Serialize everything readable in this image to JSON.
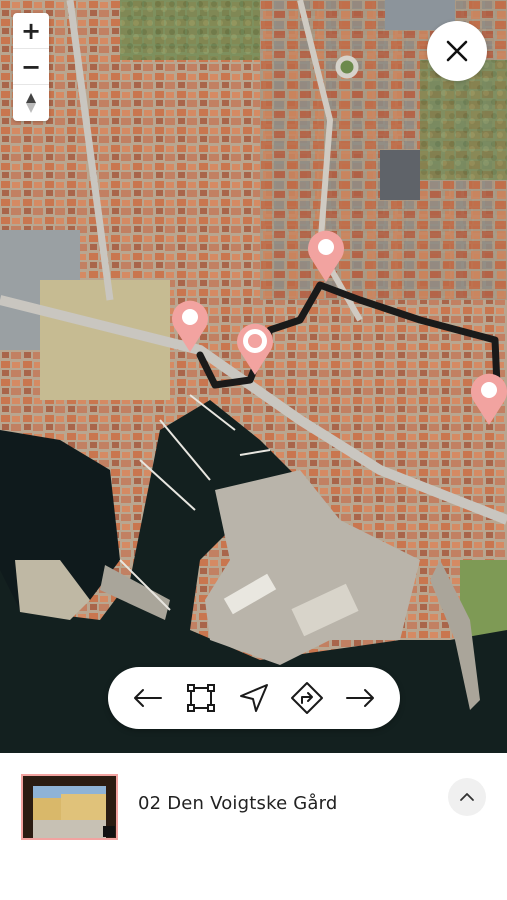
{
  "map": {
    "zoom_in_label": "+",
    "zoom_out_label": "−",
    "compass_icon": "compass-north-icon",
    "close_icon": "close-icon",
    "route_color": "#1a1a1a",
    "pin_color": "#f2a3a0",
    "pins": [
      {
        "name": "map-pin-current",
        "state": "active"
      },
      {
        "name": "map-pin-1",
        "state": "default"
      },
      {
        "name": "map-pin-2",
        "state": "default"
      },
      {
        "name": "map-pin-3",
        "state": "default"
      }
    ]
  },
  "toolbar": {
    "items": [
      {
        "icon": "arrow-left-icon",
        "action": "previous"
      },
      {
        "icon": "fit-bounds-icon",
        "action": "fit-route"
      },
      {
        "icon": "navigate-icon",
        "action": "locate"
      },
      {
        "icon": "directions-icon",
        "action": "directions"
      },
      {
        "icon": "arrow-right-icon",
        "action": "next"
      }
    ]
  },
  "stop": {
    "title": "02 Den Voigtske Gård",
    "thumbnail": "courtyard-photo",
    "accent_color": "#f2a3a0",
    "expand_icon": "chevron-up-icon"
  }
}
